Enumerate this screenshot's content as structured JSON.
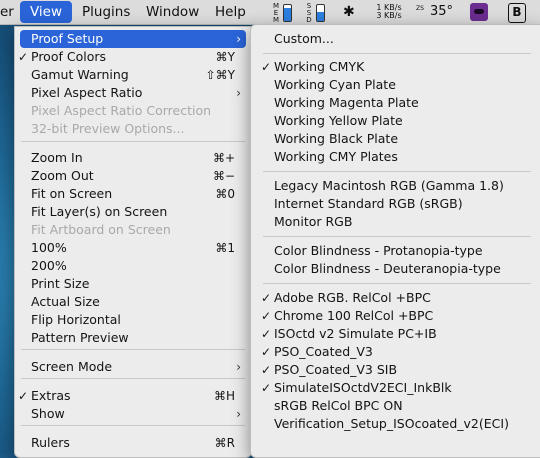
{
  "menubar": {
    "left_fragment": "er",
    "items": [
      "View",
      "Plugins",
      "Window",
      "Help"
    ],
    "status": {
      "net_up": "1 KB/s",
      "net_down": "3 KB/s",
      "temp_label_a": "ZS",
      "temp_value": "35°",
      "mem_label": "M E M",
      "ssd_label": "S S D"
    }
  },
  "view_menu": {
    "items": [
      {
        "label": "Proof Setup",
        "arrow": true,
        "highlighted": true
      },
      {
        "label": "Proof Colors",
        "check": true,
        "shortcut": "⌘Y"
      },
      {
        "label": "Gamut Warning",
        "shortcut": "⇧⌘Y"
      },
      {
        "label": "Pixel Aspect Ratio",
        "arrow": true
      },
      {
        "label": "Pixel Aspect Ratio Correction",
        "disabled": true
      },
      {
        "label": "32-bit Preview Options...",
        "disabled": true
      },
      {
        "label": "Zoom In",
        "shortcut": "⌘+"
      },
      {
        "label": "Zoom Out",
        "shortcut": "⌘−"
      },
      {
        "label": "Fit on Screen",
        "shortcut": "⌘0"
      },
      {
        "label": "Fit Layer(s) on Screen"
      },
      {
        "label": "Fit Artboard on Screen",
        "disabled": true
      },
      {
        "label": "100%",
        "shortcut": "⌘1"
      },
      {
        "label": "200%"
      },
      {
        "label": "Print Size"
      },
      {
        "label": "Actual Size"
      },
      {
        "label": "Flip Horizontal"
      },
      {
        "label": "Pattern Preview"
      },
      {
        "label": "Screen Mode",
        "arrow": true
      },
      {
        "label": "Extras",
        "check": true,
        "shortcut": "⌘H"
      },
      {
        "label": "Show",
        "arrow": true
      },
      {
        "label": "Rulers",
        "shortcut": "⌘R"
      }
    ]
  },
  "proof_submenu": {
    "items": [
      {
        "label": "Custom..."
      },
      {
        "label": "Working CMYK",
        "check": true
      },
      {
        "label": "Working Cyan Plate"
      },
      {
        "label": "Working Magenta Plate"
      },
      {
        "label": "Working Yellow Plate"
      },
      {
        "label": "Working Black Plate"
      },
      {
        "label": "Working CMY Plates"
      },
      {
        "label": "Legacy Macintosh RGB (Gamma 1.8)"
      },
      {
        "label": "Internet Standard RGB (sRGB)"
      },
      {
        "label": "Monitor RGB"
      },
      {
        "label": "Color Blindness - Protanopia-type"
      },
      {
        "label": "Color Blindness - Deuteranopia-type"
      },
      {
        "label": "Adobe RGB. RelCol +BPC",
        "check": true
      },
      {
        "label": "Chrome 100 RelCol +BPC",
        "check": true
      },
      {
        "label": "ISOctd v2 Simulate PC+IB",
        "check": true
      },
      {
        "label": "PSO_Coated_V3",
        "check": true
      },
      {
        "label": "PSO_Coated_V3 SIB",
        "check": true
      },
      {
        "label": "SimulateISOctdV2ECI_InkBlk",
        "check": true
      },
      {
        "label": "sRGB RelCol BPC ON"
      },
      {
        "label": "Verification_Setup_ISOcoated_v2(ECI)"
      }
    ]
  },
  "glyphs": {
    "check": "✓",
    "arrow": "›"
  },
  "colors": {
    "highlight": "#2a64d8",
    "menu_bg": "#ececec",
    "disabled": "#a9a9a9"
  }
}
